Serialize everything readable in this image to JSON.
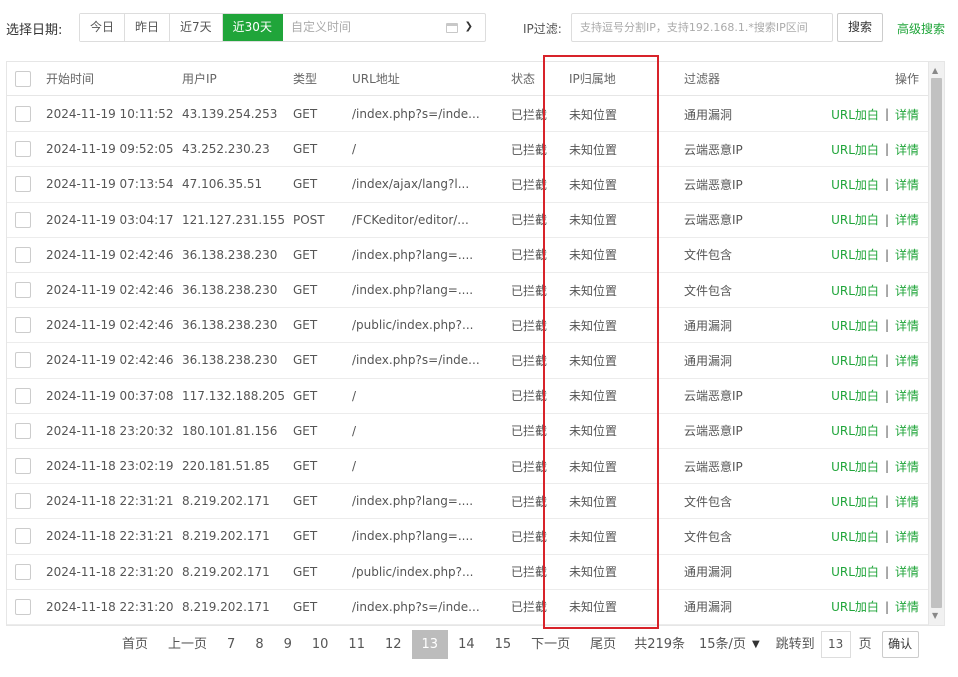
{
  "filter": {
    "date_label": "选择日期:",
    "date_buttons": [
      "今日",
      "昨日",
      "近7天",
      "近30天"
    ],
    "custom_time_placeholder": "自定义时间",
    "ip_filter_label": "IP过滤:",
    "ip_placeholder": "支持逗号分割IP，支持192.168.1.*搜索IP区间",
    "search_label": "搜索",
    "advanced_label": "高级搜索"
  },
  "table": {
    "headers": {
      "time": "开始时间",
      "ip": "用户IP",
      "type": "类型",
      "url": "URL地址",
      "status": "状态",
      "geo": "IP归属地",
      "filter": "过滤器",
      "ops": "操作"
    },
    "ops": {
      "whitelist": "URL加白",
      "sep": "|",
      "detail": "详情"
    },
    "rows": [
      {
        "time": "2024-11-19 10:11:52",
        "ip": "43.139.254.253",
        "type": "GET",
        "url": "/index.php?s=/inde...",
        "status": "已拦截",
        "geo": "未知位置",
        "filter": "通用漏洞"
      },
      {
        "time": "2024-11-19 09:52:05",
        "ip": "43.252.230.23",
        "type": "GET",
        "url": "/",
        "status": "已拦截",
        "geo": "未知位置",
        "filter": "云端恶意IP"
      },
      {
        "time": "2024-11-19 07:13:54",
        "ip": "47.106.35.51",
        "type": "GET",
        "url": "/index/ajax/lang?l...",
        "status": "已拦截",
        "geo": "未知位置",
        "filter": "云端恶意IP"
      },
      {
        "time": "2024-11-19 03:04:17",
        "ip": "121.127.231.155",
        "type": "POST",
        "url": "/FCKeditor/editor/...",
        "status": "已拦截",
        "geo": "未知位置",
        "filter": "云端恶意IP"
      },
      {
        "time": "2024-11-19 02:42:46",
        "ip": "36.138.238.230",
        "type": "GET",
        "url": "/index.php?lang=....",
        "status": "已拦截",
        "geo": "未知位置",
        "filter": "文件包含"
      },
      {
        "time": "2024-11-19 02:42:46",
        "ip": "36.138.238.230",
        "type": "GET",
        "url": "/index.php?lang=....",
        "status": "已拦截",
        "geo": "未知位置",
        "filter": "文件包含"
      },
      {
        "time": "2024-11-19 02:42:46",
        "ip": "36.138.238.230",
        "type": "GET",
        "url": "/public/index.php?...",
        "status": "已拦截",
        "geo": "未知位置",
        "filter": "通用漏洞"
      },
      {
        "time": "2024-11-19 02:42:46",
        "ip": "36.138.238.230",
        "type": "GET",
        "url": "/index.php?s=/inde...",
        "status": "已拦截",
        "geo": "未知位置",
        "filter": "通用漏洞"
      },
      {
        "time": "2024-11-19 00:37:08",
        "ip": "117.132.188.205",
        "type": "GET",
        "url": "/",
        "status": "已拦截",
        "geo": "未知位置",
        "filter": "云端恶意IP"
      },
      {
        "time": "2024-11-18 23:20:32",
        "ip": "180.101.81.156",
        "type": "GET",
        "url": "/",
        "status": "已拦截",
        "geo": "未知位置",
        "filter": "云端恶意IP"
      },
      {
        "time": "2024-11-18 23:02:19",
        "ip": "220.181.51.85",
        "type": "GET",
        "url": "/",
        "status": "已拦截",
        "geo": "未知位置",
        "filter": "云端恶意IP"
      },
      {
        "time": "2024-11-18 22:31:21",
        "ip": "8.219.202.171",
        "type": "GET",
        "url": "/index.php?lang=....",
        "status": "已拦截",
        "geo": "未知位置",
        "filter": "文件包含"
      },
      {
        "time": "2024-11-18 22:31:21",
        "ip": "8.219.202.171",
        "type": "GET",
        "url": "/index.php?lang=....",
        "status": "已拦截",
        "geo": "未知位置",
        "filter": "文件包含"
      },
      {
        "time": "2024-11-18 22:31:20",
        "ip": "8.219.202.171",
        "type": "GET",
        "url": "/public/index.php?...",
        "status": "已拦截",
        "geo": "未知位置",
        "filter": "通用漏洞"
      },
      {
        "time": "2024-11-18 22:31:20",
        "ip": "8.219.202.171",
        "type": "GET",
        "url": "/index.php?s=/inde...",
        "status": "已拦截",
        "geo": "未知位置",
        "filter": "通用漏洞"
      }
    ]
  },
  "pagination": {
    "first": "首页",
    "prev": "上一页",
    "pages": [
      "7",
      "8",
      "9",
      "10",
      "11",
      "12",
      "13",
      "14",
      "15"
    ],
    "current": "13",
    "next": "下一页",
    "last": "尾页",
    "total": "共219条",
    "page_size": "15条/页",
    "jump_label": "跳转到",
    "jump_value": "13",
    "page_unit": "页",
    "confirm": "确认"
  },
  "colors": {
    "accent": "#20a53a",
    "highlight_box": "#d8232a",
    "current_page_bg": "#bcbcbc"
  },
  "icons": {
    "calendar": "calendar-icon",
    "dropdown": "chevron-down-icon",
    "scroll_up": "scroll-up-arrow-icon",
    "scroll_down": "scroll-down-arrow-icon"
  }
}
